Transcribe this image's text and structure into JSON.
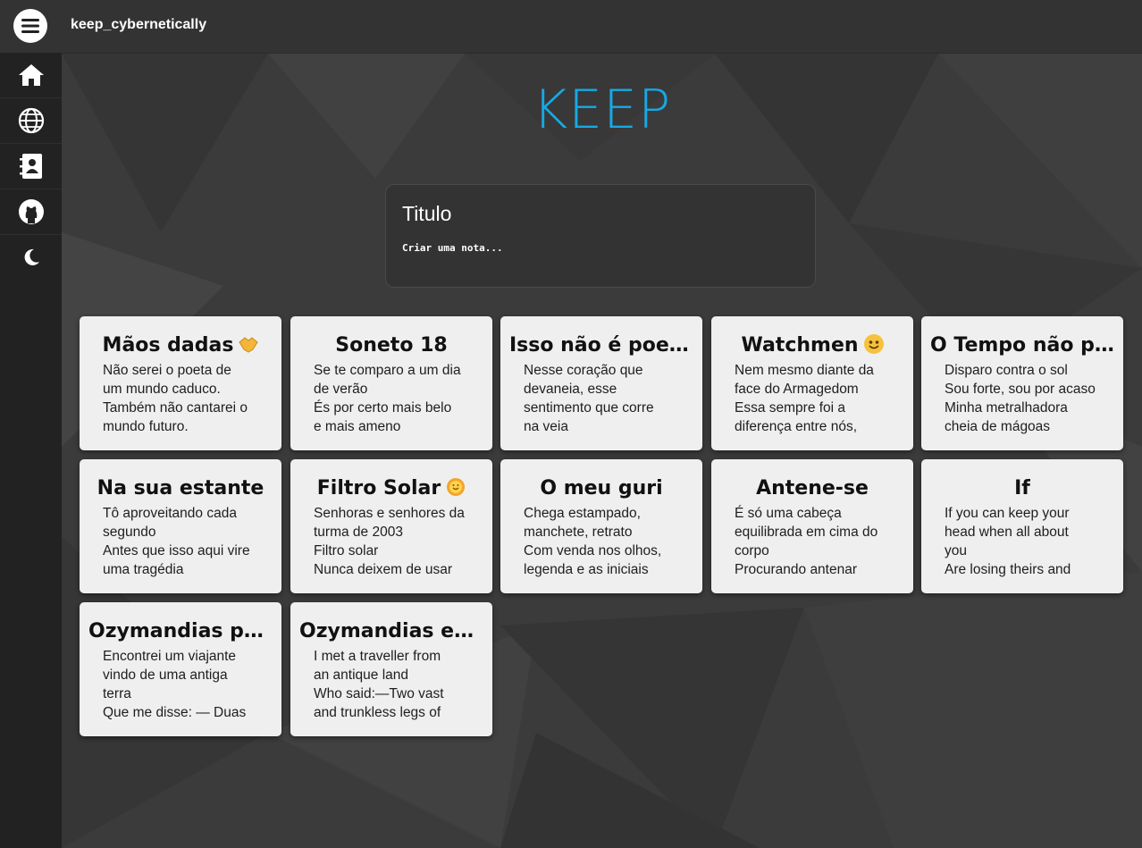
{
  "app": {
    "title": "keep_cybernetically"
  },
  "logo": "KEEP",
  "sidebar": {
    "items": [
      {
        "icon": "home-icon"
      },
      {
        "icon": "globe-icon"
      },
      {
        "icon": "contacts-book-icon"
      },
      {
        "icon": "github-icon"
      },
      {
        "icon": "moon-icon"
      }
    ]
  },
  "composer": {
    "title_placeholder": "Titulo",
    "body_placeholder": "Criar uma nota..."
  },
  "notes": [
    {
      "title": "Mãos dadas",
      "emoji": "handshake-icon",
      "lines": [
        "Não serei o poeta de",
        "um mundo caduco.",
        "Também não cantarei o",
        "mundo futuro."
      ]
    },
    {
      "title": "Soneto 18",
      "lines": [
        "Se te comparo a um dia",
        "de verão",
        "És por certo mais belo",
        "e mais ameno"
      ]
    },
    {
      "title": "Isso não é poesia",
      "lines": [
        "Nesse coração que",
        "devaneia, esse",
        "sentimento que corre",
        "na veia"
      ]
    },
    {
      "title": "Watchmen",
      "emoji": "smiley-icon",
      "lines": [
        "Nem mesmo diante da",
        "face do Armagedom",
        "Essa sempre foi a",
        "diferença entre nós,"
      ]
    },
    {
      "title": "O Tempo não p...",
      "lines": [
        "Disparo contra o sol",
        "Sou forte, sou por acaso",
        "Minha metralhadora",
        "cheia de mágoas"
      ]
    },
    {
      "title": "Na sua estante",
      "lines": [
        "Tô aproveitando cada",
        "segundo",
        "Antes que isso aqui vire",
        "uma tragédia"
      ]
    },
    {
      "title": "Filtro Solar",
      "emoji": "sun-face-icon",
      "lines": [
        "Senhoras e senhores da",
        "turma de 2003",
        "Filtro solar",
        "Nunca deixem de usar"
      ]
    },
    {
      "title": "O meu guri",
      "lines": [
        "Chega estampado,",
        "manchete, retrato",
        "Com venda nos olhos,",
        "legenda e as iniciais"
      ]
    },
    {
      "title": "Antene-se",
      "lines": [
        "É só uma cabeça",
        "equilibrada em cima do",
        "corpo",
        "Procurando antenar"
      ]
    },
    {
      "title": "If",
      "lines": [
        "If you can keep your",
        "head when all about",
        "you",
        "Are losing theirs and"
      ]
    },
    {
      "title": "Ozymandias pt...",
      "lines": [
        "Encontrei um viajante",
        "vindo de uma antiga",
        "terra",
        "Que me disse: — Duas"
      ]
    },
    {
      "title": "Ozymandias en...",
      "lines": [
        "I met a traveller from",
        "an antique land",
        "Who said:—Two vast",
        "and trunkless legs of"
      ]
    }
  ]
}
